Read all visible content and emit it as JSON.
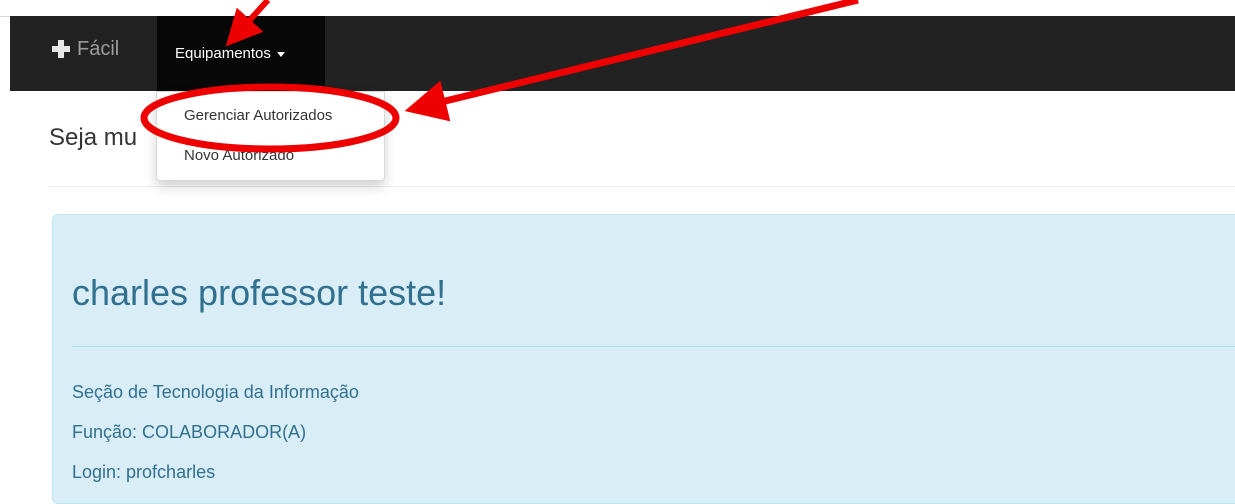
{
  "navbar": {
    "brand_label": "Fácil",
    "brand_icon": "plus-icon",
    "menu_label": "Equipamentos",
    "menu_icon": "caret-down-icon"
  },
  "dropdown": {
    "items": [
      {
        "label": "Gerenciar Autorizados"
      },
      {
        "label": "Novo Autorizado"
      }
    ]
  },
  "page": {
    "welcome_visible": "Seja mu"
  },
  "jumbotron": {
    "title": "charles professor teste!",
    "lines": [
      "Seção de Tecnologia da Informação",
      "Função: COLABORADOR(A)",
      "Login: profcharles"
    ]
  },
  "annotation": {
    "color": "#ee0000"
  }
}
